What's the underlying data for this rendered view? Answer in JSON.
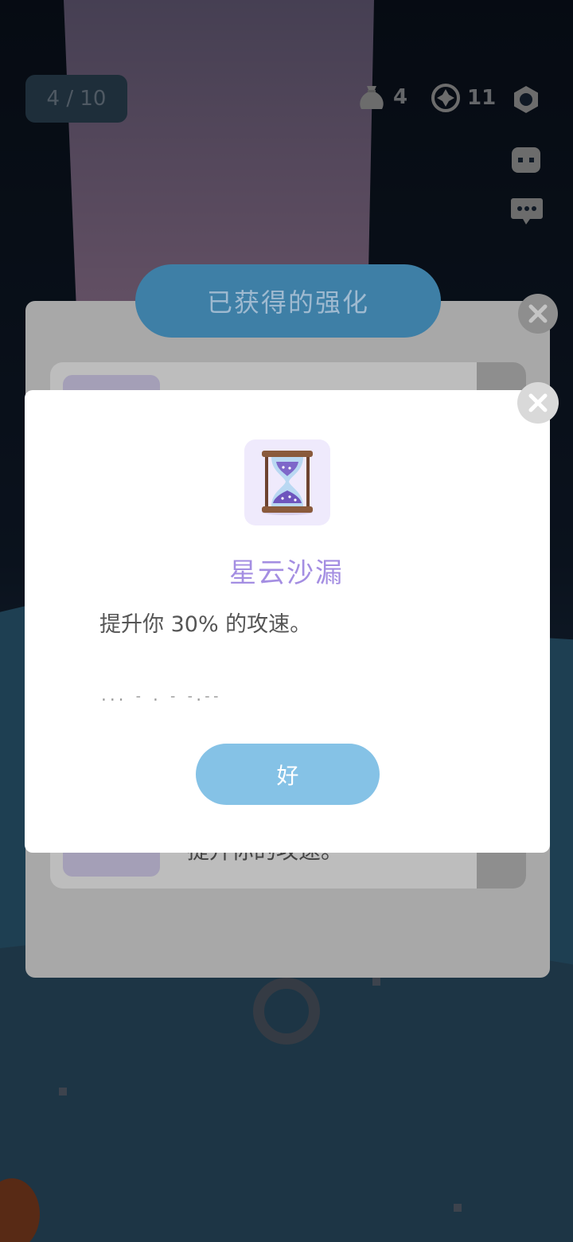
{
  "hud": {
    "stage_progress": "4 / 10",
    "bag_count": "4",
    "coin_count": "11",
    "icons": [
      "sack-icon",
      "coin-icon",
      "settings-hexagon-icon",
      "face-icon",
      "chat-icon"
    ]
  },
  "panel": {
    "title": "已获得的强化",
    "row_text": "提升你的攻速。"
  },
  "modal": {
    "item_icon": "hourglass-icon",
    "item_name": "星云沙漏",
    "description": "提升你 30% 的攻速。",
    "lore": "... - . - -.--",
    "ok_label": "好"
  },
  "colors": {
    "accent_purple": "#a48ee2",
    "button_blue": "#85c2e6",
    "title_bar_blue": "#3e7fa6"
  }
}
